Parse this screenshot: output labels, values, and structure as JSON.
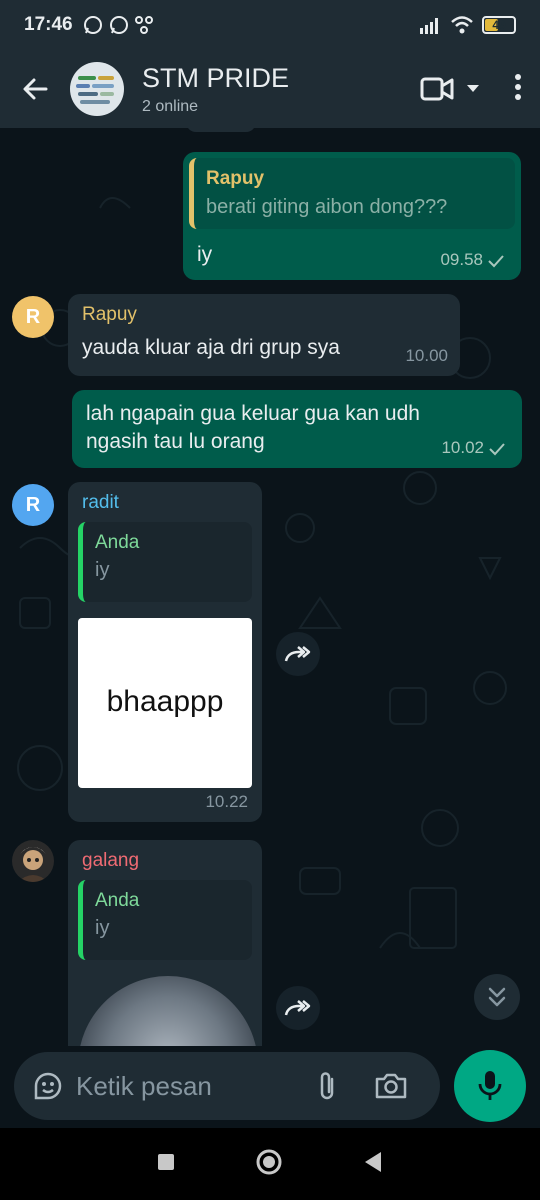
{
  "status_bar": {
    "time": "17:46",
    "battery": "49",
    "battery_level": 0.49
  },
  "header": {
    "title": "STM PRIDE",
    "subtitle": "2 online"
  },
  "messages": [
    {
      "kind": "out",
      "quote_author": "Rapuy",
      "quote_text": "berati giting aibon dong???",
      "text": "iy",
      "time": "09.58",
      "status": "sent"
    },
    {
      "kind": "in",
      "avatar_letter": "R",
      "sender": "Rapuy",
      "text": "yauda kluar aja dri grup sya",
      "time": "10.00"
    },
    {
      "kind": "out",
      "text": "lah ngapain gua keluar gua kan udh ngasih tau lu orang",
      "time": "10.02",
      "status": "sent"
    },
    {
      "kind": "in",
      "avatar_letter": "R",
      "sender": "radit",
      "quote_author": "Anda",
      "quote_text": "iy",
      "sticker_text": "bhaappp",
      "time": "10.22"
    },
    {
      "kind": "in",
      "sender": "galang",
      "quote_author": "Anda",
      "quote_text": "iy"
    }
  ],
  "composer": {
    "placeholder": "Ketik pesan"
  },
  "colors": {
    "outgoing_bubble": "#005c4b",
    "incoming_bubble": "#1f2c34",
    "accent_green": "#00a884",
    "rapuy_name": "#e2c16a",
    "radit_name": "#53bdeb",
    "galang_name": "#ef6b73"
  },
  "icons": [
    "whatsapp-icon",
    "signal-icon",
    "wifi-icon",
    "back-arrow-icon",
    "video-call-icon",
    "more-vert-icon",
    "forward-icon",
    "chevrons-down-icon",
    "sticker-icon",
    "attach-icon",
    "camera-icon",
    "mic-icon"
  ]
}
